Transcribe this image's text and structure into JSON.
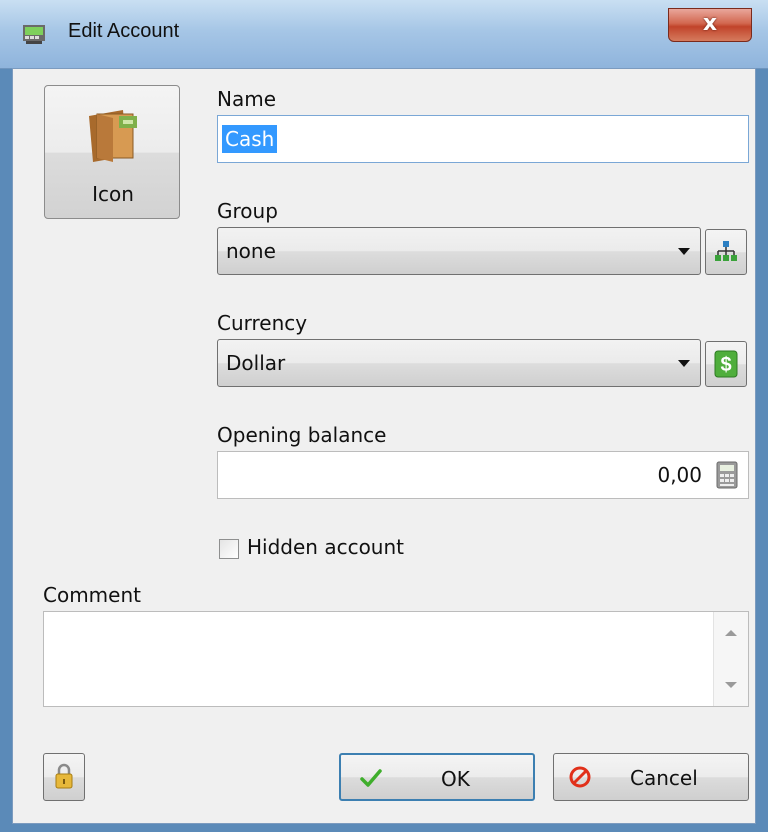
{
  "window": {
    "title": "Edit Account",
    "close_label": "x"
  },
  "icon_button": {
    "label": "Icon",
    "icon": "wallet-icon"
  },
  "name": {
    "label": "Name",
    "value": "Cash"
  },
  "group": {
    "label": "Group",
    "value": "none",
    "side_icon": "hierarchy-icon"
  },
  "currency": {
    "label": "Currency",
    "value": "Dollar",
    "side_icon": "dollar-icon"
  },
  "opening_balance": {
    "label": "Opening balance",
    "value": "0,00",
    "icon": "calculator-icon"
  },
  "hidden_account": {
    "label": "Hidden account",
    "checked": false
  },
  "comment": {
    "label": "Comment",
    "value": ""
  },
  "footer": {
    "lock_icon": "lock-icon",
    "ok_label": "OK",
    "cancel_label": "Cancel"
  },
  "colors": {
    "selection": "#3399ff",
    "focus_border": "#7aa7d6",
    "ok_check": "#3fae2c",
    "cancel_icon": "#e1301a"
  }
}
